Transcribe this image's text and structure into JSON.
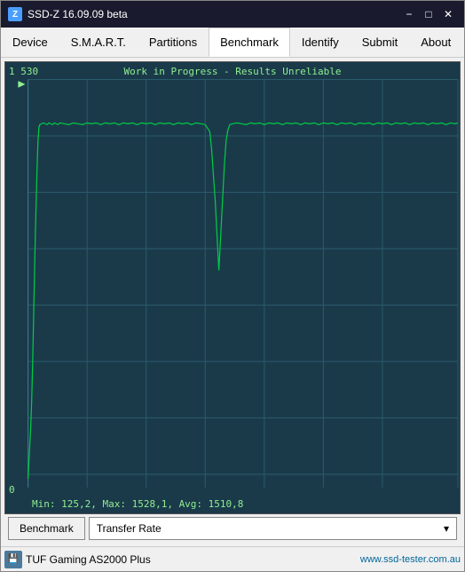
{
  "window": {
    "title": "SSD-Z 16.09.09 beta",
    "icon": "Z"
  },
  "titlebar": {
    "minimize": "−",
    "maximize": "□",
    "close": "✕"
  },
  "menu": {
    "items": [
      {
        "id": "device",
        "label": "Device",
        "active": false
      },
      {
        "id": "smart",
        "label": "S.M.A.R.T.",
        "active": false
      },
      {
        "id": "partitions",
        "label": "Partitions",
        "active": false
      },
      {
        "id": "benchmark",
        "label": "Benchmark",
        "active": true
      },
      {
        "id": "identify",
        "label": "Identify",
        "active": false
      },
      {
        "id": "submit",
        "label": "Submit",
        "active": false
      },
      {
        "id": "about",
        "label": "About",
        "active": false
      }
    ]
  },
  "chart": {
    "title": "Work in Progress - Results Unreliable",
    "y_max": "1 530",
    "y_min": "0",
    "stats": "Min: 125,2, Max: 1528,1, Avg: 1510,8",
    "grid_color": "#2a5a6a",
    "line_color": "#00cc44",
    "bg_color": "#1a3a4a"
  },
  "toolbar": {
    "benchmark_label": "Benchmark",
    "dropdown_label": "Transfer Rate",
    "dropdown_arrow": "▾"
  },
  "statusbar": {
    "drive_name": "TUF Gaming AS2000 Plus",
    "url": "www.ssd-tester.com.au"
  }
}
